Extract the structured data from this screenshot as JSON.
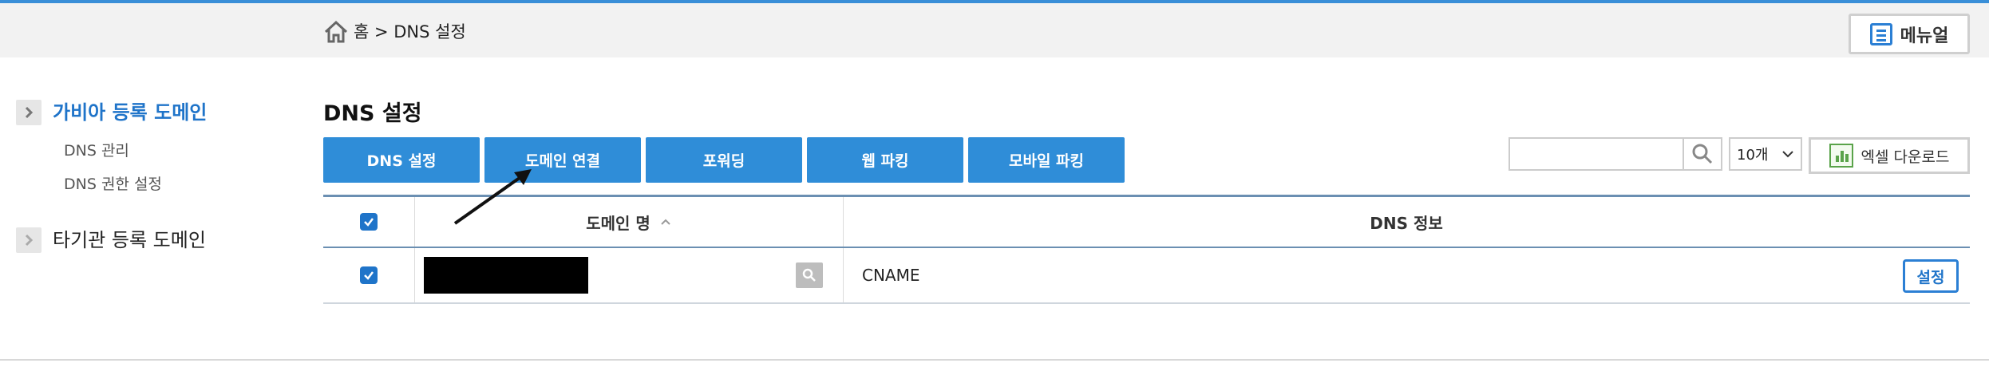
{
  "header": {
    "breadcrumb": "홈 > DNS 설정",
    "manual_label": "메뉴얼"
  },
  "sidebar": {
    "groups": [
      {
        "label": "가비아 등록 도메인",
        "active": true,
        "subitems": [
          "DNS 관리",
          "DNS 권한 설정"
        ]
      },
      {
        "label": "타기관 등록 도메인",
        "active": false,
        "subitems": []
      }
    ]
  },
  "main": {
    "title": "DNS 설정",
    "tabs": [
      "DNS 설정",
      "도메인 연결",
      "포워딩",
      "웹 파킹",
      "모바일 파킹"
    ],
    "search": {
      "value": "",
      "placeholder": ""
    },
    "page_size": "10개",
    "excel_label": "엑셀 다운로드",
    "table": {
      "headers": [
        "도메인 명",
        "DNS 정보"
      ],
      "rows": [
        {
          "checked": true,
          "domain": "",
          "dns_info": "CNAME",
          "action": "설정"
        }
      ]
    }
  },
  "colors": {
    "accent": "#2f8dd8",
    "active_link": "#1f74c9",
    "excel_green": "#5aa34a"
  },
  "icons": [
    "home-icon",
    "document-icon",
    "chevron-right-icon",
    "search-icon",
    "chevron-down-icon",
    "excel-chart-icon",
    "check-icon",
    "arrow-annotation-icon"
  ]
}
